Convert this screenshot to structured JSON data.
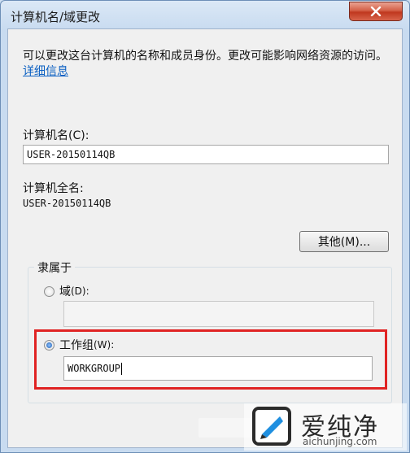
{
  "window": {
    "title": "计算机名/域更改"
  },
  "description": {
    "text": "可以更改这台计算机的名称和成员身份。更改可能影响网络资源的访问。",
    "link": "详细信息"
  },
  "computer_name": {
    "label": "计算机名(C):",
    "value": "USER-20150114QB"
  },
  "full_name": {
    "label": "计算机全名:",
    "value": "USER-20150114QB"
  },
  "buttons": {
    "other": "其他(M)..."
  },
  "member_of": {
    "title": "隶属于",
    "domain_label": "域",
    "domain_key": "(D):",
    "domain_value": "",
    "workgroup_label": "工作组",
    "workgroup_key": "(W):",
    "workgroup_value": "WORKGROUP",
    "selected": "workgroup"
  },
  "watermark": {
    "title": "爱纯净",
    "url": "aichunjing.com"
  },
  "colors": {
    "highlight": "#e02323",
    "link": "#0a5fc2",
    "close_button": "#c0381f"
  }
}
